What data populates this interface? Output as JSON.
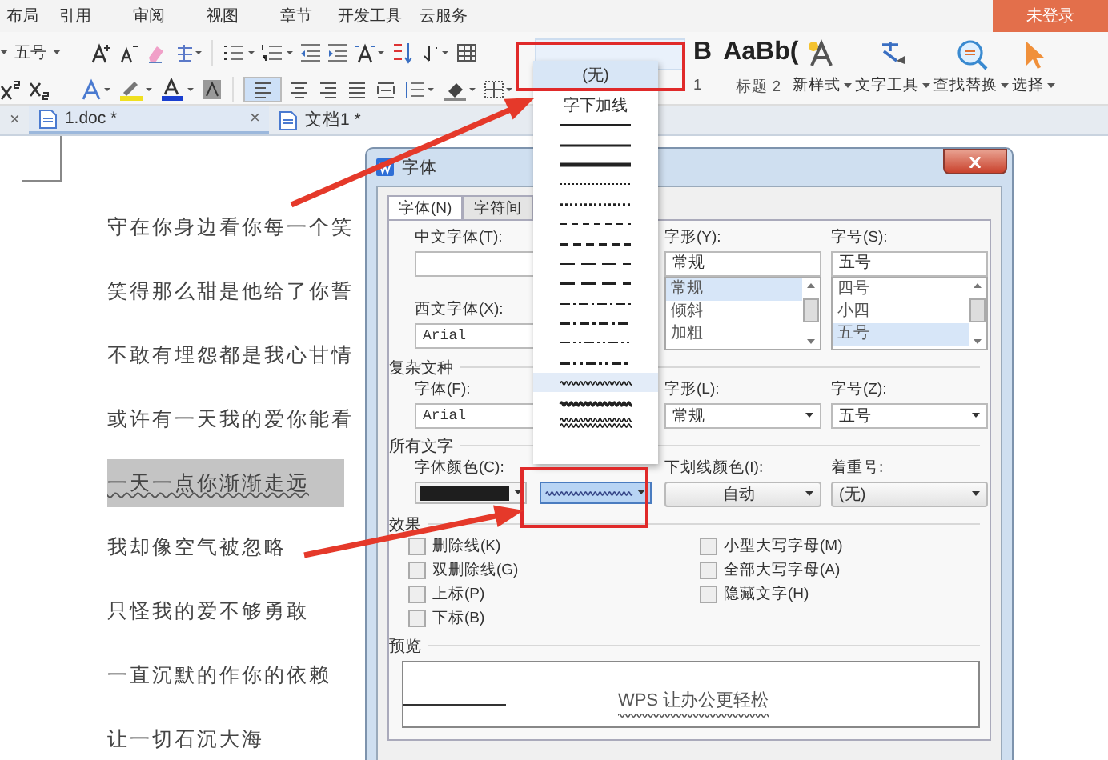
{
  "menu": {
    "items": [
      "布局",
      "引用",
      "审阅",
      "视图",
      "章节",
      "开发工具",
      "云服务"
    ],
    "login": "未登录"
  },
  "ribbon": {
    "font_size": "五号",
    "styles": [
      {
        "preview": "B",
        "label": "1"
      },
      {
        "preview": "AaBb(",
        "label": "标题 2"
      }
    ],
    "tools": [
      {
        "kind": "new-style",
        "label": "新样式"
      },
      {
        "kind": "text-tools",
        "label": "文字工具"
      },
      {
        "kind": "find-replace",
        "label": "查找替换"
      },
      {
        "kind": "select",
        "label": "选择"
      }
    ]
  },
  "tab_bar": {
    "prev_close": "×",
    "tabs": [
      {
        "label": "1.doc *",
        "close": "×",
        "selected": true
      },
      {
        "label": "文档1 *",
        "selected": false
      }
    ]
  },
  "document": {
    "lines": [
      {
        "text": "守在你身边看你每一个笑",
        "selected": false
      },
      {
        "text": "笑得那么甜是他给了你誓",
        "selected": false
      },
      {
        "text": "不敢有埋怨都是我心甘情",
        "selected": false
      },
      {
        "text": "或许有一天我的爱你能看",
        "selected": false
      },
      {
        "text": "一天一点你渐渐走远",
        "selected": true
      },
      {
        "text": "我却像空气被忽略",
        "selected": false
      },
      {
        "text": "只怪我的爱不够勇敢",
        "selected": false
      },
      {
        "text": "一直沉默的作你的依赖",
        "selected": false
      },
      {
        "text": "让一切石沉大海",
        "selected": false
      }
    ]
  },
  "font_dialog": {
    "title": "字体",
    "tabs": [
      {
        "label": "字体(N)",
        "selected": true
      },
      {
        "label": "字符间",
        "selected": false
      }
    ],
    "cn_font_label": "中文字体(T):",
    "west_font_label": "西文字体(X):",
    "west_font": "Arial",
    "style_label": "字形(Y):",
    "style_value": "常规",
    "style_list": [
      {
        "text": "常规",
        "selected": true
      },
      {
        "text": "倾斜",
        "selected": false
      },
      {
        "text": "加粗",
        "selected": false
      }
    ],
    "size_label": "字号(S):",
    "size_value": "五号",
    "size_list": [
      {
        "text": "四号",
        "selected": false
      },
      {
        "text": "小四",
        "selected": false
      },
      {
        "text": "五号",
        "selected": true
      }
    ],
    "complex_heading": "复杂文种",
    "complex_font_label": "字体(F):",
    "complex_font": "Arial",
    "complex_style_label": "字形(L):",
    "complex_style": "常规",
    "complex_size_label": "字号(Z):",
    "complex_size": "五号",
    "all_text_heading": "所有文字",
    "font_color_label": "字体颜色(C):",
    "underline_color_label": "下划线颜色(I):",
    "underline_color": "自动",
    "emphasis_label": "着重号:",
    "emphasis": "(无)",
    "effects_heading": "效果",
    "effects": [
      {
        "label": "删除线(K)",
        "checked": false
      },
      {
        "label": "小型大写字母(M)",
        "checked": false
      },
      {
        "label": "双删除线(G)",
        "checked": false
      },
      {
        "label": "全部大写字母(A)",
        "checked": false
      },
      {
        "label": "上标(P)",
        "checked": false
      },
      {
        "label": "隐藏文字(H)",
        "checked": false
      },
      {
        "label": "下标(B)",
        "checked": false
      }
    ],
    "preview_heading": "预览",
    "preview_text": "WPS 让办公更轻松"
  },
  "underline_menu": {
    "none": "(无)",
    "caption": "字下加线",
    "options": [
      {
        "kind": "solid",
        "selected": false
      },
      {
        "kind": "solid-heavy",
        "selected": false
      },
      {
        "kind": "thick",
        "selected": false
      },
      {
        "kind": "dotted",
        "selected": false
      },
      {
        "kind": "dotted-heavy",
        "selected": false
      },
      {
        "kind": "dash",
        "selected": false
      },
      {
        "kind": "dash-heavy",
        "selected": false
      },
      {
        "kind": "long-dash",
        "selected": false
      },
      {
        "kind": "long-dash-heavy",
        "selected": false
      },
      {
        "kind": "dash-dot",
        "selected": false
      },
      {
        "kind": "dash-dot-heavy",
        "selected": false
      },
      {
        "kind": "dash-dot-dot",
        "selected": false
      },
      {
        "kind": "dash-dot-dot-heavy",
        "selected": false
      },
      {
        "kind": "wave",
        "selected": true
      },
      {
        "kind": "wave-heavy",
        "selected": false
      },
      {
        "kind": "wave-double",
        "selected": false
      }
    ]
  }
}
